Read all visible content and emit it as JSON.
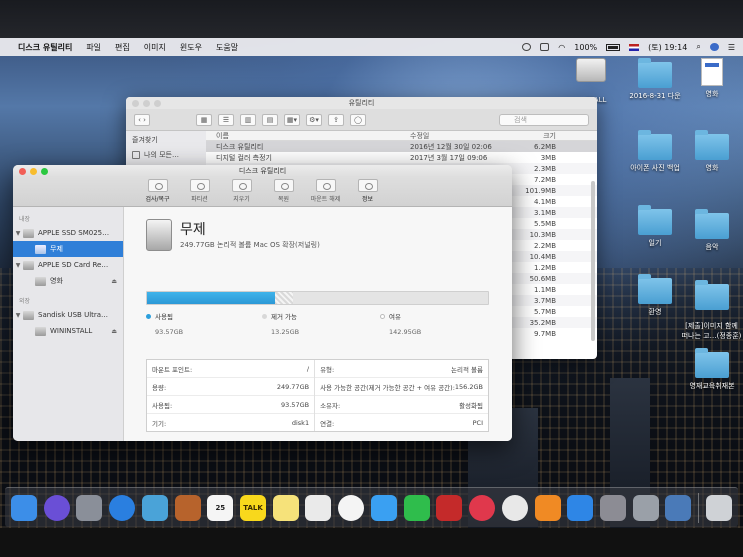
{
  "menubar": {
    "app_name": "디스크 유틸리티",
    "items": [
      "파일",
      "편집",
      "이미지",
      "윈도우",
      "도움말"
    ],
    "battery": "100%",
    "clock": "(토) 19:14"
  },
  "desktop": {
    "icons": [
      {
        "label": "",
        "type": "disk"
      },
      {
        "label": "STALL",
        "type": "none"
      },
      {
        "label": "2016-8-31 다운",
        "type": "folder"
      },
      {
        "label": "영화",
        "type": "doc"
      },
      {
        "label": "",
        "type": "folder"
      },
      {
        "label": "",
        "type": "folder"
      },
      {
        "label": "아이폰 사진 백업",
        "type": "folder"
      },
      {
        "label": "영화",
        "type": "folder"
      },
      {
        "label": "일기",
        "type": "folder"
      },
      {
        "label": "음악",
        "type": "folder"
      },
      {
        "label": "환영",
        "type": "folder"
      },
      {
        "label": "[제출]이미지 함께\n떠나는 고…(정종훈)",
        "type": "folder"
      },
      {
        "label": "영재교육취재본",
        "type": "folder"
      }
    ]
  },
  "finder": {
    "title": "유틸리티",
    "search_placeholder": "검색",
    "sidebar_header": "즐겨찾기",
    "sidebar_items": [
      "나의 모든…"
    ],
    "columns": {
      "name": "이름",
      "date": "수정일",
      "size": "크기"
    },
    "rows": [
      {
        "name": "디스크 유틸리티",
        "date": "2016년 12월 30일 02:06",
        "size": "6.2MB"
      },
      {
        "name": "디지털 컬러 측정기",
        "date": "2017년 3월 17일 09:06",
        "size": "3MB"
      },
      {
        "name": "",
        "date": "",
        "size": "2.3MB"
      },
      {
        "name": "",
        "date": "",
        "size": "7.2MB"
      },
      {
        "name": "",
        "date": "",
        "size": "101.9MB"
      },
      {
        "name": "",
        "date": "",
        "size": "4.1MB"
      },
      {
        "name": "",
        "date": "",
        "size": "3.1MB"
      },
      {
        "name": "",
        "date": "",
        "size": "5.5MB"
      },
      {
        "name": "",
        "date": "",
        "size": "10.3MB"
      },
      {
        "name": "",
        "date": "",
        "size": "2.2MB"
      },
      {
        "name": "",
        "date": "",
        "size": "10.4MB"
      },
      {
        "name": "",
        "date": "",
        "size": "1.2MB"
      },
      {
        "name": "",
        "date": "",
        "size": "50.6MB"
      },
      {
        "name": "",
        "date": "",
        "size": "1.1MB"
      },
      {
        "name": "",
        "date": "",
        "size": "3.7MB"
      },
      {
        "name": "",
        "date": "",
        "size": "5.7MB"
      },
      {
        "name": "",
        "date": "",
        "size": "35.2MB"
      },
      {
        "name": "",
        "date": "",
        "size": "9.7MB"
      }
    ]
  },
  "disk_utility": {
    "title": "디스크 유틸리티",
    "toolbar": [
      {
        "label": "검사/복구",
        "icon": "stethoscope-icon",
        "enabled": true
      },
      {
        "label": "파티션",
        "icon": "pie-icon",
        "enabled": false
      },
      {
        "label": "지우기",
        "icon": "erase-icon",
        "enabled": false
      },
      {
        "label": "복원",
        "icon": "restore-icon",
        "enabled": false
      },
      {
        "label": "마운트 해제",
        "icon": "eject-icon",
        "enabled": false
      },
      {
        "label": "정보",
        "icon": "info-icon",
        "enabled": true
      }
    ],
    "sidebar": {
      "internal_label": "내장",
      "external_label": "외장",
      "internal": [
        {
          "name": "APPLE SSD SM025…",
          "child": false,
          "selected": false,
          "eject": false
        },
        {
          "name": "무제",
          "child": true,
          "selected": true,
          "eject": false
        },
        {
          "name": "APPLE SD Card Re…",
          "child": false,
          "selected": false,
          "eject": false
        },
        {
          "name": "영화",
          "child": true,
          "selected": false,
          "eject": true
        }
      ],
      "external": [
        {
          "name": "Sandisk USB Ultra…",
          "child": false,
          "selected": false,
          "eject": false
        },
        {
          "name": "WININSTALL",
          "child": true,
          "selected": false,
          "eject": true
        }
      ]
    },
    "volume": {
      "name": "무제",
      "subtitle": "249.77GB 논리적 볼륨 Mac OS 확장(저널링)"
    },
    "usage": {
      "total_gb": 249.77,
      "used_gb": 93.57,
      "purgeable_gb": 13.25,
      "free_gb": 142.95,
      "used_label": "사용됨",
      "used_value": "93.57GB",
      "purgeable_label": "제거 가능",
      "purgeable_value": "13.25GB",
      "free_label": "여유",
      "free_value": "142.95GB",
      "used_color": "#2c9fdc",
      "purgeable_color": "#d8d8d8",
      "free_color": "#ffffff"
    },
    "info_left": [
      {
        "key": "마운트 포인트:",
        "value": "/"
      },
      {
        "key": "용량:",
        "value": "249.77GB"
      },
      {
        "key": "사용됨:",
        "value": "93.57GB"
      },
      {
        "key": "기기:",
        "value": "disk1"
      }
    ],
    "info_right": [
      {
        "key": "유형:",
        "value": "논리적 볼륨"
      },
      {
        "key": "사용 가능한 공간(제거 가능한 공간 + 여유 공간):",
        "value": "156.2GB"
      },
      {
        "key": "소유자:",
        "value": "활성화됨"
      },
      {
        "key": "연결:",
        "value": "PCI"
      }
    ]
  },
  "dock": {
    "apps": [
      {
        "name": "finder",
        "color": "#3c8ee8",
        "label": ""
      },
      {
        "name": "siri",
        "color": "#6a4fd6",
        "label": ""
      },
      {
        "name": "launchpad",
        "color": "#8a8f99",
        "label": ""
      },
      {
        "name": "safari",
        "color": "#2a7fe0",
        "label": ""
      },
      {
        "name": "preview",
        "color": "#4aa3d8",
        "label": ""
      },
      {
        "name": "notes-book",
        "color": "#b7632c",
        "label": ""
      },
      {
        "name": "calendar",
        "color": "#f5f5f5",
        "label": "25"
      },
      {
        "name": "kakaotalk",
        "color": "#f8d81c",
        "label": "TALK"
      },
      {
        "name": "stickies",
        "color": "#f6e27a",
        "label": ""
      },
      {
        "name": "photos-app",
        "color": "#eaeaea",
        "label": ""
      },
      {
        "name": "photos",
        "color": "#f4f4f4",
        "label": ""
      },
      {
        "name": "messages",
        "color": "#3aa0f2",
        "label": ""
      },
      {
        "name": "facetime",
        "color": "#2fbd4c",
        "label": ""
      },
      {
        "name": "photo-booth",
        "color": "#c42a2a",
        "label": ""
      },
      {
        "name": "itunes-radio",
        "color": "#e0384c",
        "label": ""
      },
      {
        "name": "itunes",
        "color": "#e8e8e8",
        "label": ""
      },
      {
        "name": "ibooks",
        "color": "#f08a24",
        "label": ""
      },
      {
        "name": "app-store",
        "color": "#2e86e6",
        "label": ""
      },
      {
        "name": "system-preferences",
        "color": "#8c8c94",
        "label": ""
      },
      {
        "name": "disk-utility",
        "color": "#9aa0a8",
        "label": ""
      },
      {
        "name": "notes-blue",
        "color": "#4a7ab8",
        "label": ""
      },
      {
        "name": "trash",
        "color": "#cfd2d6",
        "label": ""
      }
    ]
  }
}
